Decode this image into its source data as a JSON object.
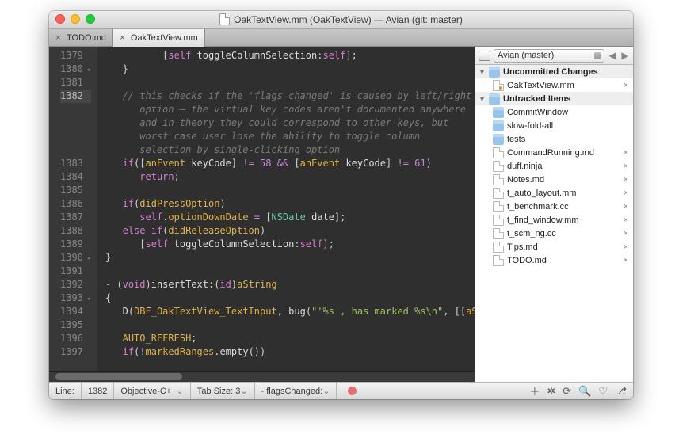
{
  "window": {
    "title": "OakTextView.mm (OakTextView) — Avian (git: master)"
  },
  "tabs": [
    {
      "name": "TODO.md",
      "active": false
    },
    {
      "name": "OakTextView.mm",
      "active": true
    }
  ],
  "code": {
    "lines": [
      {
        "n": 1379,
        "frag": [
          [
            "p",
            "          ["
          ],
          [
            "s",
            "self"
          ],
          [
            "p",
            " "
          ],
          [
            "f",
            "toggleColumnSelection"
          ],
          [
            "p",
            ":"
          ],
          [
            "s",
            "self"
          ],
          [
            "p",
            "];"
          ]
        ]
      },
      {
        "n": 1380,
        "frag": [
          [
            "p",
            "   }"
          ]
        ],
        "fold": "▾"
      },
      {
        "n": 1381,
        "frag": [
          [
            "p",
            ""
          ]
        ]
      },
      {
        "n": 1382,
        "cur": true,
        "frag": [
          [
            "c",
            "   // this checks if the 'flags changed' is caused by left/right"
          ]
        ]
      },
      {
        "n": null,
        "frag": [
          [
            "c",
            "      option — the virtual key codes aren't documented anywhere"
          ]
        ]
      },
      {
        "n": null,
        "frag": [
          [
            "c",
            "      and in theory they could correspond to other keys, but"
          ]
        ]
      },
      {
        "n": null,
        "frag": [
          [
            "c",
            "      worst case user lose the ability to toggle column"
          ]
        ]
      },
      {
        "n": null,
        "frag": [
          [
            "c",
            "      selection by single-clicking option"
          ]
        ]
      },
      {
        "n": 1383,
        "frag": [
          [
            "p",
            "   "
          ],
          [
            "k",
            "if"
          ],
          [
            "p",
            "(["
          ],
          [
            "v",
            "anEvent"
          ],
          [
            "p",
            " "
          ],
          [
            "f",
            "keyCode"
          ],
          [
            "p",
            "] "
          ],
          [
            "o",
            "!= "
          ],
          [
            "n",
            "58"
          ],
          [
            "p",
            " "
          ],
          [
            "o",
            "&&"
          ],
          [
            "p",
            " ["
          ],
          [
            "v",
            "anEvent"
          ],
          [
            "p",
            " "
          ],
          [
            "f",
            "keyCode"
          ],
          [
            "p",
            "] "
          ],
          [
            "o",
            "!= "
          ],
          [
            "n",
            "61"
          ],
          [
            "p",
            ")"
          ]
        ]
      },
      {
        "n": 1384,
        "frag": [
          [
            "p",
            "      "
          ],
          [
            "k",
            "return"
          ],
          [
            "p",
            ";"
          ]
        ]
      },
      {
        "n": 1385,
        "frag": [
          [
            "p",
            ""
          ]
        ]
      },
      {
        "n": 1386,
        "frag": [
          [
            "p",
            "   "
          ],
          [
            "k",
            "if"
          ],
          [
            "p",
            "("
          ],
          [
            "v",
            "didPressOption"
          ],
          [
            "p",
            ")"
          ]
        ]
      },
      {
        "n": 1387,
        "frag": [
          [
            "p",
            "      "
          ],
          [
            "s",
            "self"
          ],
          [
            "p",
            "."
          ],
          [
            "v",
            "optionDownDate"
          ],
          [
            "p",
            " "
          ],
          [
            "o",
            "="
          ],
          [
            "p",
            " ["
          ],
          [
            "t",
            "NSDate"
          ],
          [
            "p",
            " "
          ],
          [
            "f",
            "date"
          ],
          [
            "p",
            "];"
          ]
        ]
      },
      {
        "n": 1388,
        "frag": [
          [
            "p",
            "   "
          ],
          [
            "k",
            "else if"
          ],
          [
            "p",
            "("
          ],
          [
            "v",
            "didReleaseOption"
          ],
          [
            "p",
            ")"
          ]
        ]
      },
      {
        "n": 1389,
        "frag": [
          [
            "p",
            "      ["
          ],
          [
            "s",
            "self"
          ],
          [
            "p",
            " "
          ],
          [
            "f",
            "toggleColumnSelection"
          ],
          [
            "p",
            ":"
          ],
          [
            "s",
            "self"
          ],
          [
            "p",
            "];"
          ]
        ]
      },
      {
        "n": 1390,
        "frag": [
          [
            "p",
            "}"
          ]
        ],
        "fold": "▾"
      },
      {
        "n": 1391,
        "frag": [
          [
            "p",
            ""
          ]
        ]
      },
      {
        "n": 1392,
        "frag": [
          [
            "o",
            "-"
          ],
          [
            "p",
            " ("
          ],
          [
            "k",
            "void"
          ],
          [
            "p",
            ")"
          ],
          [
            "f",
            "insertText"
          ],
          [
            "p",
            ":("
          ],
          [
            "k",
            "id"
          ],
          [
            "p",
            ")"
          ],
          [
            "v",
            "aString"
          ]
        ]
      },
      {
        "n": 1393,
        "frag": [
          [
            "p",
            "{"
          ]
        ],
        "fold": "▾"
      },
      {
        "n": 1394,
        "frag": [
          [
            "p",
            "   "
          ],
          [
            "f",
            "D"
          ],
          [
            "p",
            "("
          ],
          [
            "v",
            "DBF_OakTextView_TextInput"
          ],
          [
            "p",
            ", "
          ],
          [
            "f",
            "bug"
          ],
          [
            "p",
            "("
          ],
          [
            "q",
            "\"'%s', has marked %s\\n\""
          ],
          [
            "p",
            ", [["
          ],
          [
            "v",
            "aSt"
          ]
        ]
      },
      {
        "n": 1395,
        "frag": [
          [
            "p",
            ""
          ]
        ]
      },
      {
        "n": 1396,
        "frag": [
          [
            "p",
            "   "
          ],
          [
            "v",
            "AUTO_REFRESH"
          ],
          [
            "p",
            ";"
          ]
        ]
      },
      {
        "n": 1397,
        "frag": [
          [
            "p",
            "   "
          ],
          [
            "k",
            "if"
          ],
          [
            "p",
            "("
          ],
          [
            "o",
            "!"
          ],
          [
            "v",
            "markedRanges"
          ],
          [
            "p",
            "."
          ],
          [
            "f",
            "empty"
          ],
          [
            "p",
            "())"
          ]
        ]
      }
    ]
  },
  "fileBrowser": {
    "header": "Avian (master)",
    "groups": [
      {
        "title": "Uncommitted Changes",
        "items": [
          {
            "name": "OakTextView.mm",
            "type": "file",
            "dirty": true,
            "close": true
          }
        ]
      },
      {
        "title": "Untracked Items",
        "items": [
          {
            "name": "CommitWindow",
            "type": "folder"
          },
          {
            "name": "slow-fold-all",
            "type": "folder"
          },
          {
            "name": "tests",
            "type": "folder"
          },
          {
            "name": "CommandRunning.md",
            "type": "file",
            "close": true
          },
          {
            "name": "duff.ninja",
            "type": "file",
            "close": true
          },
          {
            "name": "Notes.md",
            "type": "file",
            "close": true
          },
          {
            "name": "t_auto_layout.mm",
            "type": "file",
            "close": true
          },
          {
            "name": "t_benchmark.cc",
            "type": "file",
            "close": true
          },
          {
            "name": "t_find_window.mm",
            "type": "file",
            "close": true
          },
          {
            "name": "t_scm_ng.cc",
            "type": "file",
            "close": true
          },
          {
            "name": "Tips.md",
            "type": "file",
            "close": true
          },
          {
            "name": "TODO.md",
            "type": "file",
            "close": true
          }
        ]
      }
    ]
  },
  "status": {
    "lineLabel": "Line:",
    "line": "1382",
    "grammar": "Objective-C++",
    "tabLabel": "Tab Size:",
    "tabSize": "3",
    "symbol": "- flagsChanged:"
  }
}
